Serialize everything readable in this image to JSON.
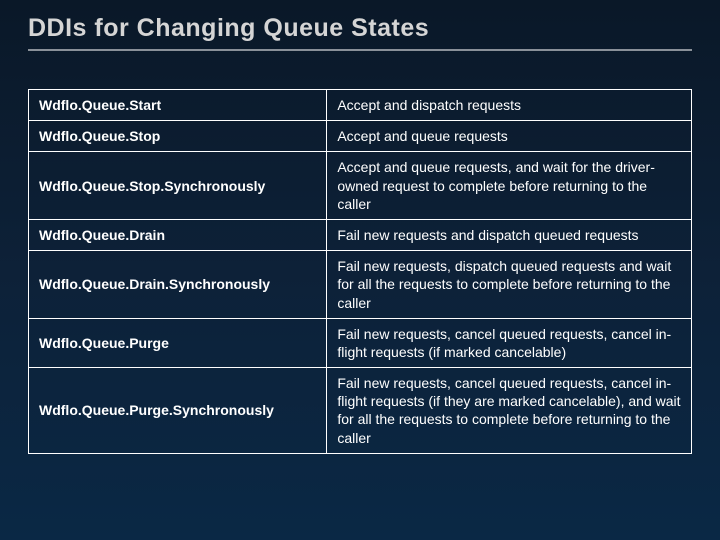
{
  "title": "DDIs for Changing Queue States",
  "rows": [
    {
      "func": "Wdflo.Queue.Start",
      "desc": "Accept and dispatch requests"
    },
    {
      "func": "Wdflo.Queue.Stop",
      "desc": "Accept and queue requests"
    },
    {
      "func": "Wdflo.Queue.Stop.Synchronously",
      "desc": "Accept and queue requests, and wait for the driver-owned request to complete before returning to the caller"
    },
    {
      "func": "Wdflo.Queue.Drain",
      "desc": "Fail new requests and dispatch queued requests"
    },
    {
      "func": "Wdflo.Queue.Drain.Synchronously",
      "desc": "Fail new requests, dispatch queued requests and wait for all the requests to complete before returning to the caller"
    },
    {
      "func": "Wdflo.Queue.Purge",
      "desc": "Fail new requests, cancel queued requests, cancel in-flight requests (if marked cancelable)"
    },
    {
      "func": "Wdflo.Queue.Purge.Synchronously",
      "desc": "Fail new requests, cancel queued requests, cancel in-flight requests (if they are marked cancelable), and wait for all the requests to complete before returning to the caller"
    }
  ]
}
